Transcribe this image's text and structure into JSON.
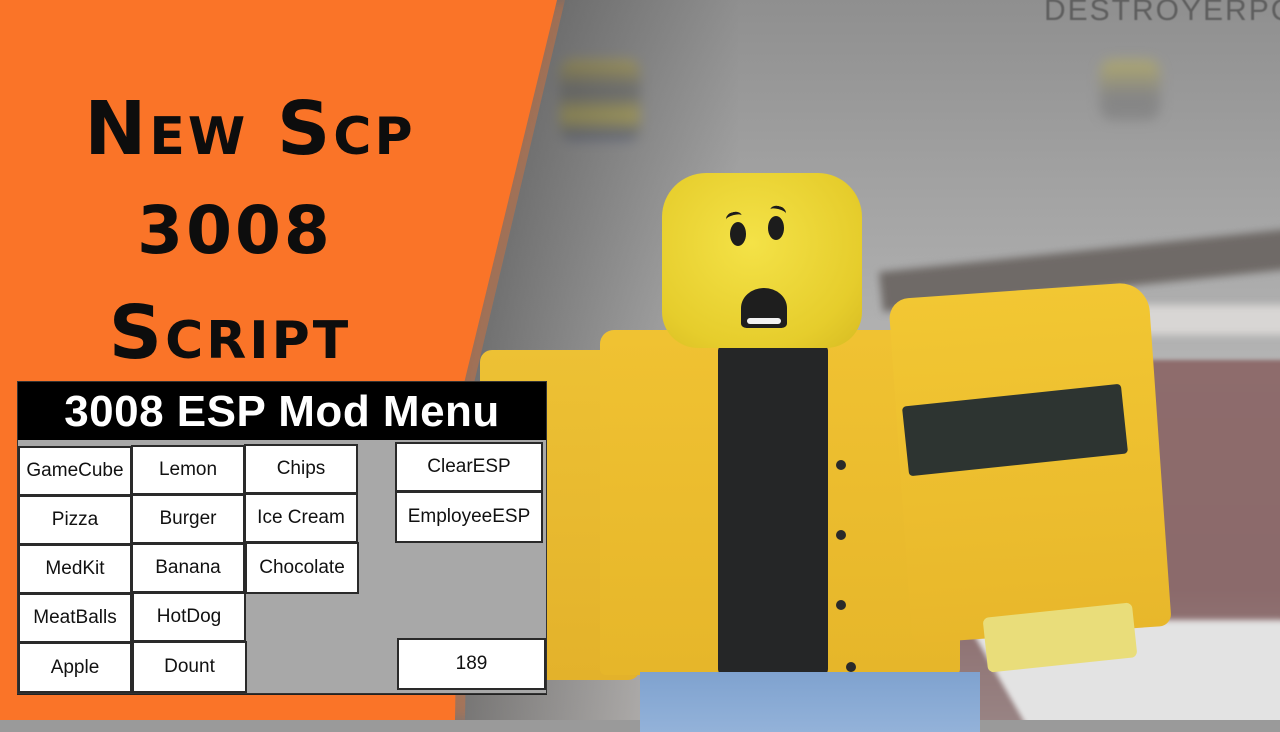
{
  "thumbnail": {
    "headline": [
      "New Scp",
      "3008",
      "Script"
    ],
    "watermark": "DESTROYERPC",
    "colors": {
      "orange_panel": "#fa7428",
      "headline_text": "#0d0d0d",
      "menu_title_bg": "#000000",
      "menu_title_text": "#ffffff",
      "menu_body_bg": "#a8a8a8",
      "button_bg": "#ffffff"
    }
  },
  "menu": {
    "title": "3008 ESP Mod Menu",
    "columns": [
      {
        "name": "col-1",
        "buttons": [
          "GameCube",
          "Pizza",
          "MedKit",
          "MeatBalls",
          "Apple"
        ]
      },
      {
        "name": "col-2",
        "buttons": [
          "Lemon",
          "Burger",
          "Banana",
          "HotDog",
          "Dount"
        ]
      },
      {
        "name": "col-3",
        "buttons": [
          "Chips",
          "Ice Cream",
          "Chocolate"
        ]
      },
      {
        "name": "esp",
        "buttons": [
          "ClearESP",
          "EmployeeESP"
        ]
      }
    ],
    "counter_value": "189"
  },
  "scene": {
    "character": "yellow blocky avatar with scared face, yellow jacket, black shirt, armband, blue pants",
    "icons": [
      "scared-face-icon"
    ]
  }
}
